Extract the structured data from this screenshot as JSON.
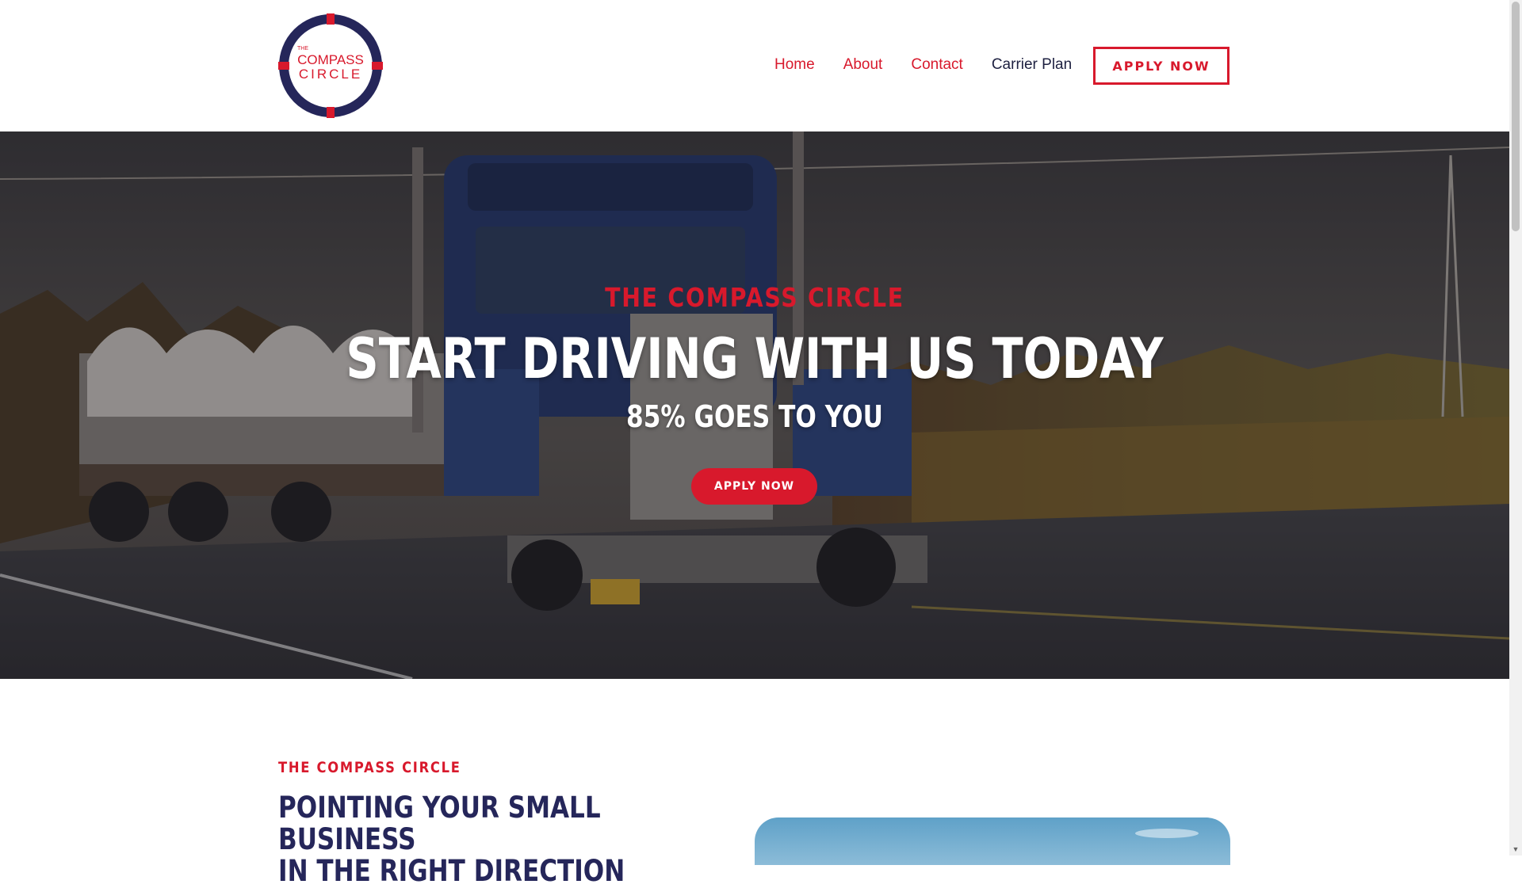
{
  "header": {
    "logo": {
      "small_text": "THE",
      "line1": "COMPASS",
      "line2": "CIRCLE",
      "colors": {
        "ring": "#25265a",
        "accent": "#d8192c"
      }
    },
    "nav": [
      {
        "label": "Home"
      },
      {
        "label": "About"
      },
      {
        "label": "Contact"
      },
      {
        "label": "Carrier Plan"
      }
    ],
    "apply_button": "APPLY NOW"
  },
  "hero": {
    "eyebrow": "THE COMPASS CIRCLE",
    "title": "START DRIVING WITH US TODAY",
    "subtitle": "85% GOES TO YOU",
    "button": "APPLY NOW",
    "background": "photo of a blue semi truck hauling a flatbed load on a wet highway"
  },
  "about": {
    "eyebrow": "THE COMPASS CIRCLE",
    "title_line1": "POINTING YOUR SMALL BUSINESS",
    "title_line2": "IN THE RIGHT DIRECTION"
  },
  "colors": {
    "brand_red": "#d8192c",
    "brand_navy": "#25265a",
    "nav_dark": "#1d2040"
  }
}
